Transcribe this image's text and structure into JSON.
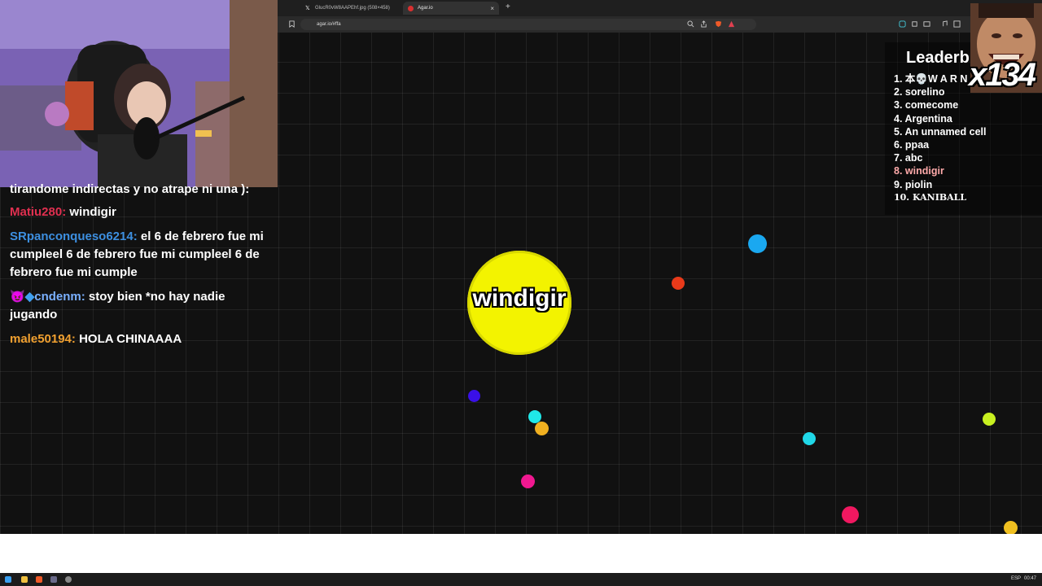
{
  "browser": {
    "tabs": [
      {
        "label": "GlucR0vW8AAPEhf.jpg (508×458)",
        "active": false
      },
      {
        "label": "Agar.io",
        "active": true
      }
    ],
    "new_tab": "+",
    "close_tab": "×",
    "url": "agar.io/#ffa"
  },
  "chat": {
    "messages": [
      {
        "user": "",
        "text": "tirandome indirectas y no atrape ni una ):",
        "color": "#ffffff"
      },
      {
        "user": "Matiu280:",
        "text": " windigir",
        "color": "#e03050"
      },
      {
        "user": "SRpanconqueso6214:",
        "text": " el 6 de febrero fue mi cumpleel 6 de febrero fue mi cumpleel 6 de febrero fue mi cumple",
        "color": "#3d8fe0"
      },
      {
        "user": "cndenm:",
        "text": " stoy bien *no hay nadie jugando",
        "color": "#7ab0ff"
      },
      {
        "user": "male50194:",
        "text": " HOLA CHINAAAA",
        "color": "#f0a030"
      }
    ]
  },
  "game": {
    "player_name": "windigir",
    "player_color": "#f3f300",
    "pellets": [
      {
        "color": "#1aa8f0"
      },
      {
        "color": "#e83a1a"
      },
      {
        "color": "#3a10e8"
      },
      {
        "color": "#20e8e8"
      },
      {
        "color": "#f0b020"
      },
      {
        "color": "#f01890"
      },
      {
        "color": "#20d8e8"
      },
      {
        "color": "#c8f020"
      },
      {
        "color": "#f01860"
      },
      {
        "color": "#f0c020"
      }
    ]
  },
  "leaderboard": {
    "title": "Leaderb",
    "rows": [
      {
        "rank": "1.",
        "name": "本💀W A R N I N G"
      },
      {
        "rank": "2.",
        "name": "sorelino"
      },
      {
        "rank": "3.",
        "name": "comecome"
      },
      {
        "rank": "4.",
        "name": "Argentina"
      },
      {
        "rank": "5.",
        "name": "An unnamed cell"
      },
      {
        "rank": "6.",
        "name": "ppaa"
      },
      {
        "rank": "7.",
        "name": "abc"
      },
      {
        "rank": "8.",
        "name": "windigir",
        "highlight": true
      },
      {
        "rank": "9.",
        "name": "piolin"
      },
      {
        "rank": "10.",
        "name": "KANIBALL"
      }
    ]
  },
  "overlay": {
    "counter": "x134"
  },
  "taskbar": {
    "lang": "ESP",
    "time": "00:47"
  }
}
